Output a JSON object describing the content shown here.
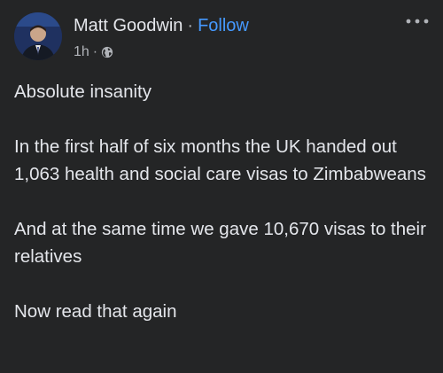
{
  "post": {
    "author": "Matt Goodwin",
    "separator": "·",
    "follow_label": "Follow",
    "timestamp": "1h",
    "meta_separator": "·",
    "audience_icon": "globe-icon",
    "more_icon": "more-horizontal-icon",
    "paragraphs": [
      "Absolute insanity",
      "In the first half of six months the UK handed out 1,063 health and social care visas to Zimbabweans",
      "And at the same time we gave 10,670 visas to their relatives",
      "Now read that again"
    ]
  },
  "colors": {
    "background": "#242526",
    "text_primary": "#e4e6eb",
    "text_secondary": "#b0b3b8",
    "link": "#4599ff"
  }
}
